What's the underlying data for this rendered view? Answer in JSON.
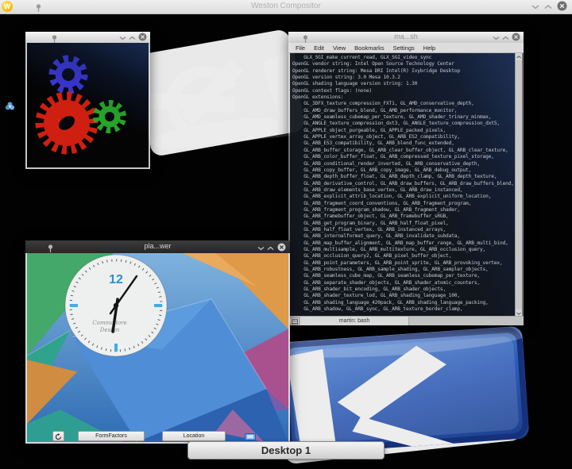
{
  "weston_bar": {
    "logo_letter": "W",
    "title": "Weston Compositor"
  },
  "terminal": {
    "title": "ma...sh",
    "menu": [
      "File",
      "Edit",
      "View",
      "Bookmarks",
      "Settings",
      "Help"
    ],
    "tab_label": "martin: bash",
    "output_lines": [
      "    GLX_SGI_make_current_read, GLX_SGI_video_sync",
      "OpenGL vendor string: Intel Open Source Technology Center",
      "OpenGL renderer string: Mesa DRI Intel(R) Ivybridge Desktop",
      "OpenGL version string: 3.0 Mesa 10.3.2",
      "OpenGL shading language version string: 1.30",
      "OpenGL context flags: (none)",
      "OpenGL extensions:",
      "    GL_3DFX_texture_compression_FXT1, GL_AMD_conservative_depth,",
      "    GL_AMD_draw_buffers_blend, GL_AMD_performance_monitor,",
      "    GL_AMD_seamless_cubemap_per_texture, GL_AMD_shader_trinary_minmax,",
      "    GL_ANGLE_texture_compression_dxt3, GL_ANGLE_texture_compression_dxt5,",
      "    GL_APPLE_object_purgeable, GL_APPLE_packed_pixels,",
      "    GL_APPLE_vertex_array_object, GL_ARB_ES2_compatibility,",
      "    GL_ARB_ES3_compatibility, GL_ARB_blend_func_extended,",
      "    GL_ARB_buffer_storage, GL_ARB_clear_buffer_object, GL_ARB_clear_texture,",
      "    GL_ARB_color_buffer_float, GL_ARB_compressed_texture_pixel_storage,",
      "    GL_ARB_conditional_render_inverted, GL_ARB_conservative_depth,",
      "    GL_ARB_copy_buffer, GL_ARB_copy_image, GL_ARB_debug_output,",
      "    GL_ARB_depth_buffer_float, GL_ARB_depth_clamp, GL_ARB_depth_texture,",
      "    GL_ARB_derivative_control, GL_ARB_draw_buffers, GL_ARB_draw_buffers_blend,",
      "    GL_ARB_draw_elements_base_vertex, GL_ARB_draw_instanced,",
      "    GL_ARB_explicit_attrib_location, GL_ARB_explicit_uniform_location,",
      "    GL_ARB_fragment_coord_conventions, GL_ARB_fragment_program,",
      "    GL_ARB_fragment_program_shadow, GL_ARB_fragment_shader,",
      "    GL_ARB_framebuffer_object, GL_ARB_framebuffer_sRGB,",
      "    GL_ARB_get_program_binary, GL_ARB_half_float_pixel,",
      "    GL_ARB_half_float_vertex, GL_ARB_instanced_arrays,",
      "    GL_ARB_internalformat_query, GL_ARB_invalidate_subdata,",
      "    GL_ARB_map_buffer_alignment, GL_ARB_map_buffer_range, GL_ARB_multi_bind,",
      "    GL_ARB_multisample, GL_ARB_multitexture, GL_ARB_occlusion_query,",
      "    GL_ARB_occlusion_query2, GL_ARB_pixel_buffer_object,",
      "    GL_ARB_point_parameters, GL_ARB_point_sprite, GL_ARB_provoking_vertex,",
      "    GL_ARB_robustness, GL_ARB_sample_shading, GL_ARB_sampler_objects,",
      "    GL_ARB_seamless_cube_map, GL_ARB_seamless_cubemap_per_texture,",
      "    GL_ARB_separate_shader_objects, GL_ARB_shader_atomic_counters,",
      "    GL_ARB_shader_bit_encoding, GL_ARB_shader_objects,",
      "    GL_ARB_shader_texture_lod, GL_ARB_shading_language_100,",
      "    GL_ARB_shading_language_420pack, GL_ARB_shading_language_packing,",
      "    GL_ARB_shadow, GL_ARB_sync, GL_ARB_texture_border_clamp,"
    ]
  },
  "gears_window": {
    "gear_colors": {
      "blue": "#3b35d6",
      "red": "#cf1f10",
      "green": "#27a527"
    }
  },
  "plasma": {
    "title": "pla...wer",
    "clock": {
      "hour_label": "12",
      "signature_line1": "Commodore",
      "signature_line2": "Design"
    },
    "toolbar": {
      "form_factors": "FormFactors",
      "location": "Location"
    }
  },
  "desktop_overlay": {
    "label": "Desktop 1"
  },
  "colors": {
    "desktop_bg": "#020202",
    "kde_blue": "#2f5cb5",
    "plasma_accent": "#3daee9",
    "titlebar_light": "#d9d9d9",
    "titlebar_dark": "#2e2e2e",
    "gear_blue": "#3b35d6",
    "gear_red": "#cf1f10",
    "gear_green": "#27a527"
  }
}
